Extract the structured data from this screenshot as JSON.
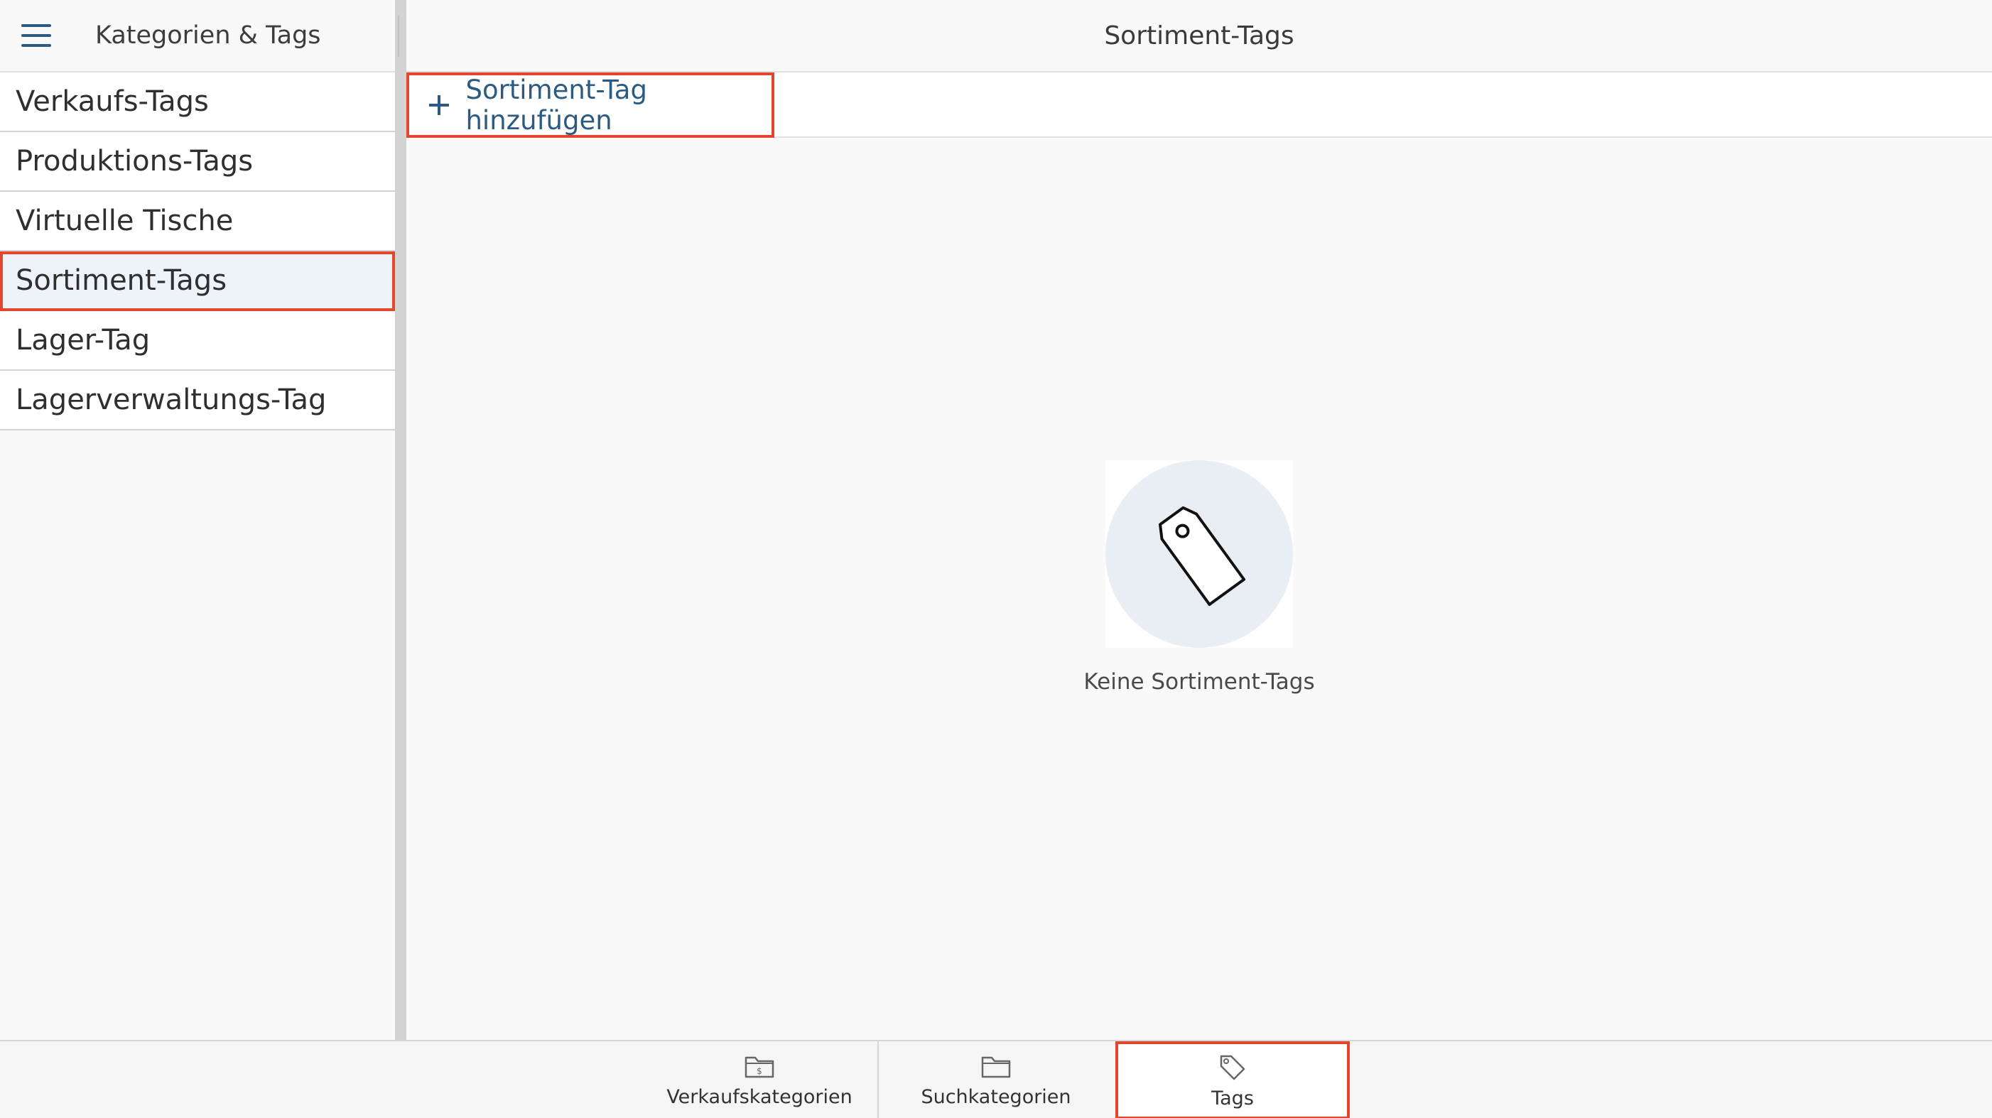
{
  "sidebar": {
    "title": "Kategorien & Tags",
    "items": [
      {
        "label": "Verkaufs-Tags"
      },
      {
        "label": "Produktions-Tags"
      },
      {
        "label": "Virtuelle Tische"
      },
      {
        "label": "Sortiment-Tags"
      },
      {
        "label": "Lager-Tag"
      },
      {
        "label": "Lagerverwaltungs-Tag"
      }
    ],
    "active_index": 3
  },
  "main": {
    "title": "Sortiment-Tags",
    "add_button_label": "Sortiment-Tag hinzufügen",
    "empty_state_text": "Keine Sortiment-Tags",
    "empty_state_icon": "price-tag-icon"
  },
  "tabbar": {
    "tabs": [
      {
        "label": "Verkaufskategorien",
        "icon": "folder-dollar-icon"
      },
      {
        "label": "Suchkategorien",
        "icon": "folder-icon"
      },
      {
        "label": "Tags",
        "icon": "tag-icon"
      }
    ],
    "active_index": 2
  },
  "colors": {
    "accent": "#2b5b83",
    "highlight": "#e4462d",
    "active_row_bg": "#eef3fa",
    "empty_circle_bg": "#e9eef5"
  }
}
